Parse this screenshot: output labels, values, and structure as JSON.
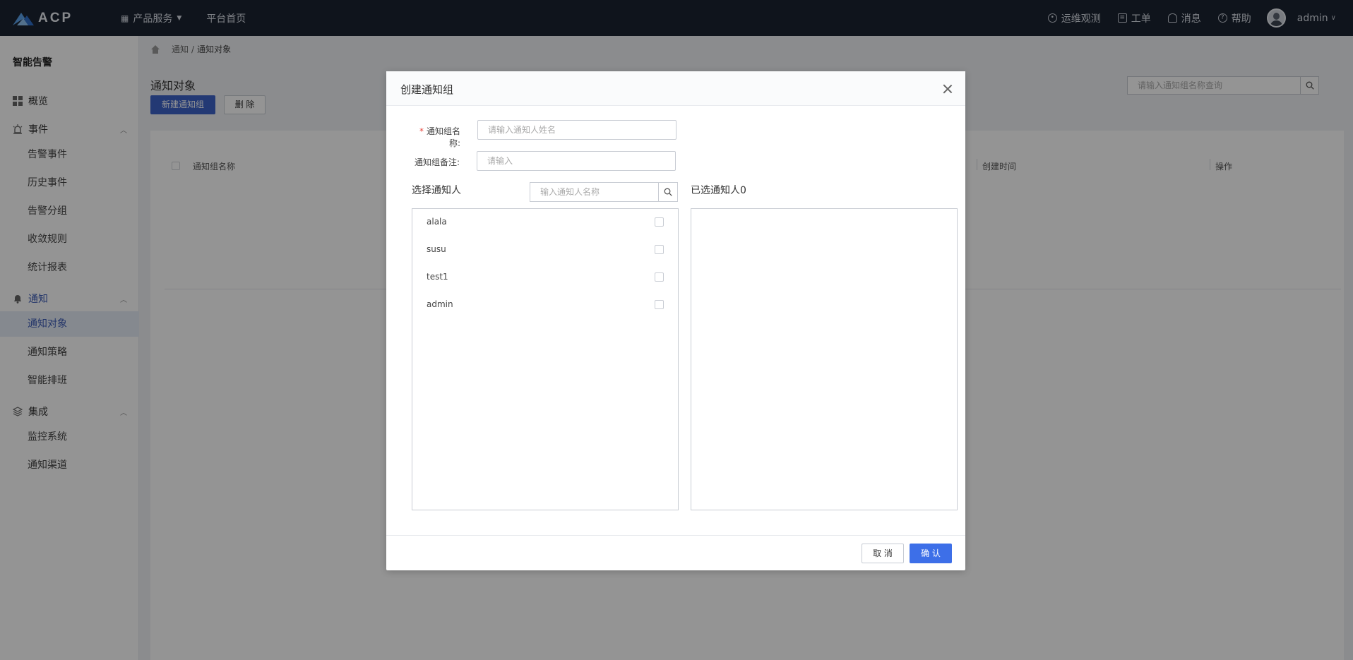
{
  "topbar": {
    "logo_text": "ACP",
    "nav": [
      {
        "label": "产品服务",
        "icon": "grid-icon"
      },
      {
        "label": "平台首页"
      }
    ],
    "right": [
      {
        "label": "运维观测",
        "icon": "location-icon"
      },
      {
        "label": "工单",
        "icon": "clipboard-icon"
      },
      {
        "label": "消息",
        "icon": "bell-icon"
      },
      {
        "label": "帮助",
        "icon": "help-icon"
      }
    ],
    "user": "admin"
  },
  "sidebar": {
    "title": "智能告警",
    "overview": "概览",
    "groups": [
      {
        "label": "事件",
        "items": [
          "告警事件",
          "历史事件",
          "告警分组",
          "收敛规则",
          "统计报表"
        ]
      },
      {
        "label": "通知",
        "items": [
          "通知对象",
          "通知策略",
          "智能排班"
        ]
      },
      {
        "label": "集成",
        "items": [
          "监控系统",
          "通知渠道"
        ]
      }
    ],
    "active_item": "通知对象"
  },
  "breadcrumb": {
    "parent": "通知",
    "separator": "/",
    "current": "通知对象"
  },
  "page": {
    "title": "通知对象",
    "new_button": "新建通知组",
    "delete_button": "删 除",
    "search_placeholder": "请输入通知组名称查询",
    "columns": [
      "通知组名称",
      "创建时间",
      "操作"
    ]
  },
  "modal": {
    "title": "创建通知组",
    "name_label": "通知组名称:",
    "name_placeholder": "请输入通知人姓名",
    "remark_label": "通知组备注:",
    "remark_placeholder": "请输入",
    "select_title": "选择通知人",
    "person_search_placeholder": "输入通知人名称",
    "selected_title": "已选通知人0",
    "people": [
      "alala",
      "susu",
      "test1",
      "admin"
    ],
    "cancel": "取 消",
    "confirm": "确 认"
  }
}
